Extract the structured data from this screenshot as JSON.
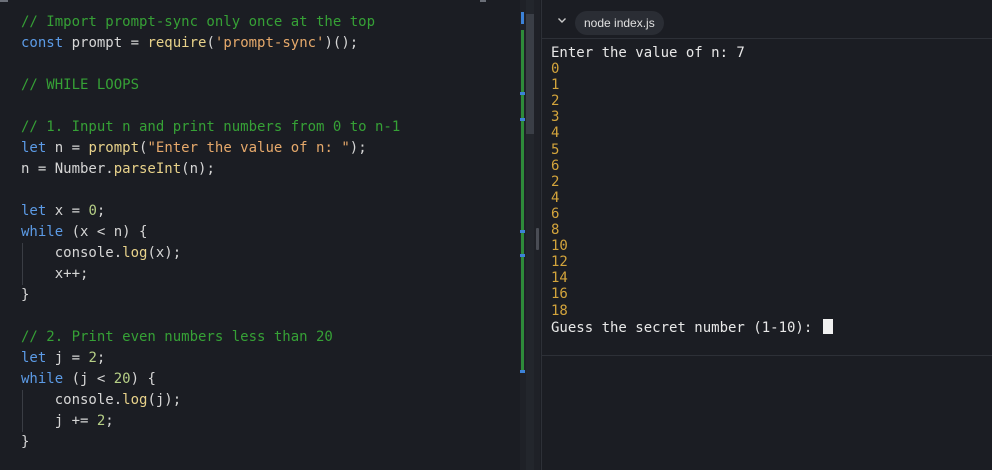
{
  "editor": {
    "lines": [
      [
        {
          "t": "// Import prompt-sync only once at the top",
          "c": "comment"
        }
      ],
      [
        {
          "t": "const",
          "c": "kw"
        },
        {
          "t": " prompt = ",
          "c": "plain"
        },
        {
          "t": "require",
          "c": "fn"
        },
        {
          "t": "(",
          "c": "plain"
        },
        {
          "t": "'prompt-sync'",
          "c": "str"
        },
        {
          "t": ")();",
          "c": "plain"
        }
      ],
      [],
      [
        {
          "t": "// WHILE LOOPS",
          "c": "comment"
        }
      ],
      [],
      [
        {
          "t": "// 1. Input n and print numbers from 0 to n-1",
          "c": "comment"
        }
      ],
      [
        {
          "t": "let",
          "c": "kw"
        },
        {
          "t": " n = ",
          "c": "plain"
        },
        {
          "t": "prompt",
          "c": "fn"
        },
        {
          "t": "(",
          "c": "plain"
        },
        {
          "t": "\"Enter the value of n: \"",
          "c": "str"
        },
        {
          "t": ");",
          "c": "plain"
        }
      ],
      [
        {
          "t": "n = Number.",
          "c": "plain"
        },
        {
          "t": "parseInt",
          "c": "fn"
        },
        {
          "t": "(n);",
          "c": "plain"
        }
      ],
      [],
      [
        {
          "t": "let",
          "c": "kw"
        },
        {
          "t": " x = ",
          "c": "plain"
        },
        {
          "t": "0",
          "c": "num"
        },
        {
          "t": ";",
          "c": "plain"
        }
      ],
      [
        {
          "t": "while",
          "c": "kw"
        },
        {
          "t": " (x < n) {",
          "c": "plain"
        }
      ],
      [
        {
          "t": "    console.",
          "c": "plain",
          "g": true
        },
        {
          "t": "log",
          "c": "fn"
        },
        {
          "t": "(x);",
          "c": "plain"
        }
      ],
      [
        {
          "t": "    x++;",
          "c": "plain",
          "g": true
        }
      ],
      [
        {
          "t": "}",
          "c": "plain"
        }
      ],
      [],
      [
        {
          "t": "// 2. Print even numbers less than 20",
          "c": "comment"
        }
      ],
      [
        {
          "t": "let",
          "c": "kw"
        },
        {
          "t": " j = ",
          "c": "plain"
        },
        {
          "t": "2",
          "c": "num"
        },
        {
          "t": ";",
          "c": "plain"
        }
      ],
      [
        {
          "t": "while",
          "c": "kw"
        },
        {
          "t": " (j < ",
          "c": "plain"
        },
        {
          "t": "20",
          "c": "num"
        },
        {
          "t": ") {",
          "c": "plain"
        }
      ],
      [
        {
          "t": "    console.",
          "c": "plain",
          "g": true
        },
        {
          "t": "log",
          "c": "fn"
        },
        {
          "t": "(j);",
          "c": "plain"
        }
      ],
      [
        {
          "t": "    j += ",
          "c": "plain",
          "g": true
        },
        {
          "t": "2",
          "c": "num"
        },
        {
          "t": ";",
          "c": "plain"
        }
      ],
      [
        {
          "t": "}",
          "c": "plain"
        }
      ]
    ]
  },
  "terminal": {
    "tab_label": "node index.js",
    "output": [
      {
        "t": "Enter the value of n: 7",
        "c": "prompt"
      },
      {
        "t": "0",
        "c": "num"
      },
      {
        "t": "1",
        "c": "num"
      },
      {
        "t": "2",
        "c": "num"
      },
      {
        "t": "3",
        "c": "num"
      },
      {
        "t": "4",
        "c": "num"
      },
      {
        "t": "5",
        "c": "num"
      },
      {
        "t": "6",
        "c": "num"
      },
      {
        "t": "2",
        "c": "num"
      },
      {
        "t": "4",
        "c": "num"
      },
      {
        "t": "6",
        "c": "num"
      },
      {
        "t": "8",
        "c": "num"
      },
      {
        "t": "10",
        "c": "num"
      },
      {
        "t": "12",
        "c": "num"
      },
      {
        "t": "14",
        "c": "num"
      },
      {
        "t": "16",
        "c": "num"
      },
      {
        "t": "18",
        "c": "num"
      },
      {
        "t": "Guess the secret number (1-10): ",
        "c": "prompt",
        "cursor": true
      }
    ]
  },
  "colors": {
    "comment": "#36a136",
    "keyword": "#5c9be6",
    "function": "#e8d28a",
    "string": "#e6a96b",
    "number": "#b6cf86",
    "terminal_number": "#d3a43c",
    "git_added": "#2e8b3a",
    "git_modified": "#3c82d8"
  },
  "icons": {
    "terminal_collapse": "chevron-down-icon"
  }
}
